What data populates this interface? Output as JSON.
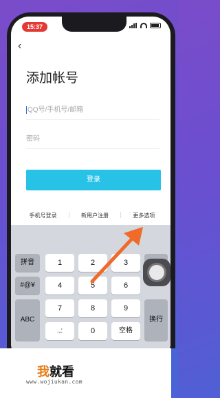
{
  "status_bar": {
    "time": "15:37"
  },
  "page": {
    "back_glyph": "‹",
    "title": "添加帐号"
  },
  "form": {
    "account_placeholder": "QQ号/手机号/邮箱",
    "password_placeholder": "密码",
    "login_label": "登录"
  },
  "links": [
    {
      "label": "手机号登录"
    },
    {
      "label": "新用户注册"
    },
    {
      "label": "更多选项"
    }
  ],
  "keyboard": {
    "pinyin": "拼音",
    "symbols": "#@¥",
    "abc": "ABC",
    "digits": [
      "1",
      "2",
      "3",
      "4",
      "5",
      "6",
      "7",
      "8",
      "9",
      "0"
    ],
    "punct": ".,:",
    "space": "空格",
    "enter": "换行",
    "delete_glyph": "⌫"
  },
  "watermark": {
    "logo_mark": "我",
    "logo_text": "就看",
    "url": "www.wojiukan.com"
  },
  "colors": {
    "accent": "#27c2e6",
    "arrow": "#f06a2a",
    "time_pill": "#e53935",
    "background": "#6a4fd0"
  }
}
